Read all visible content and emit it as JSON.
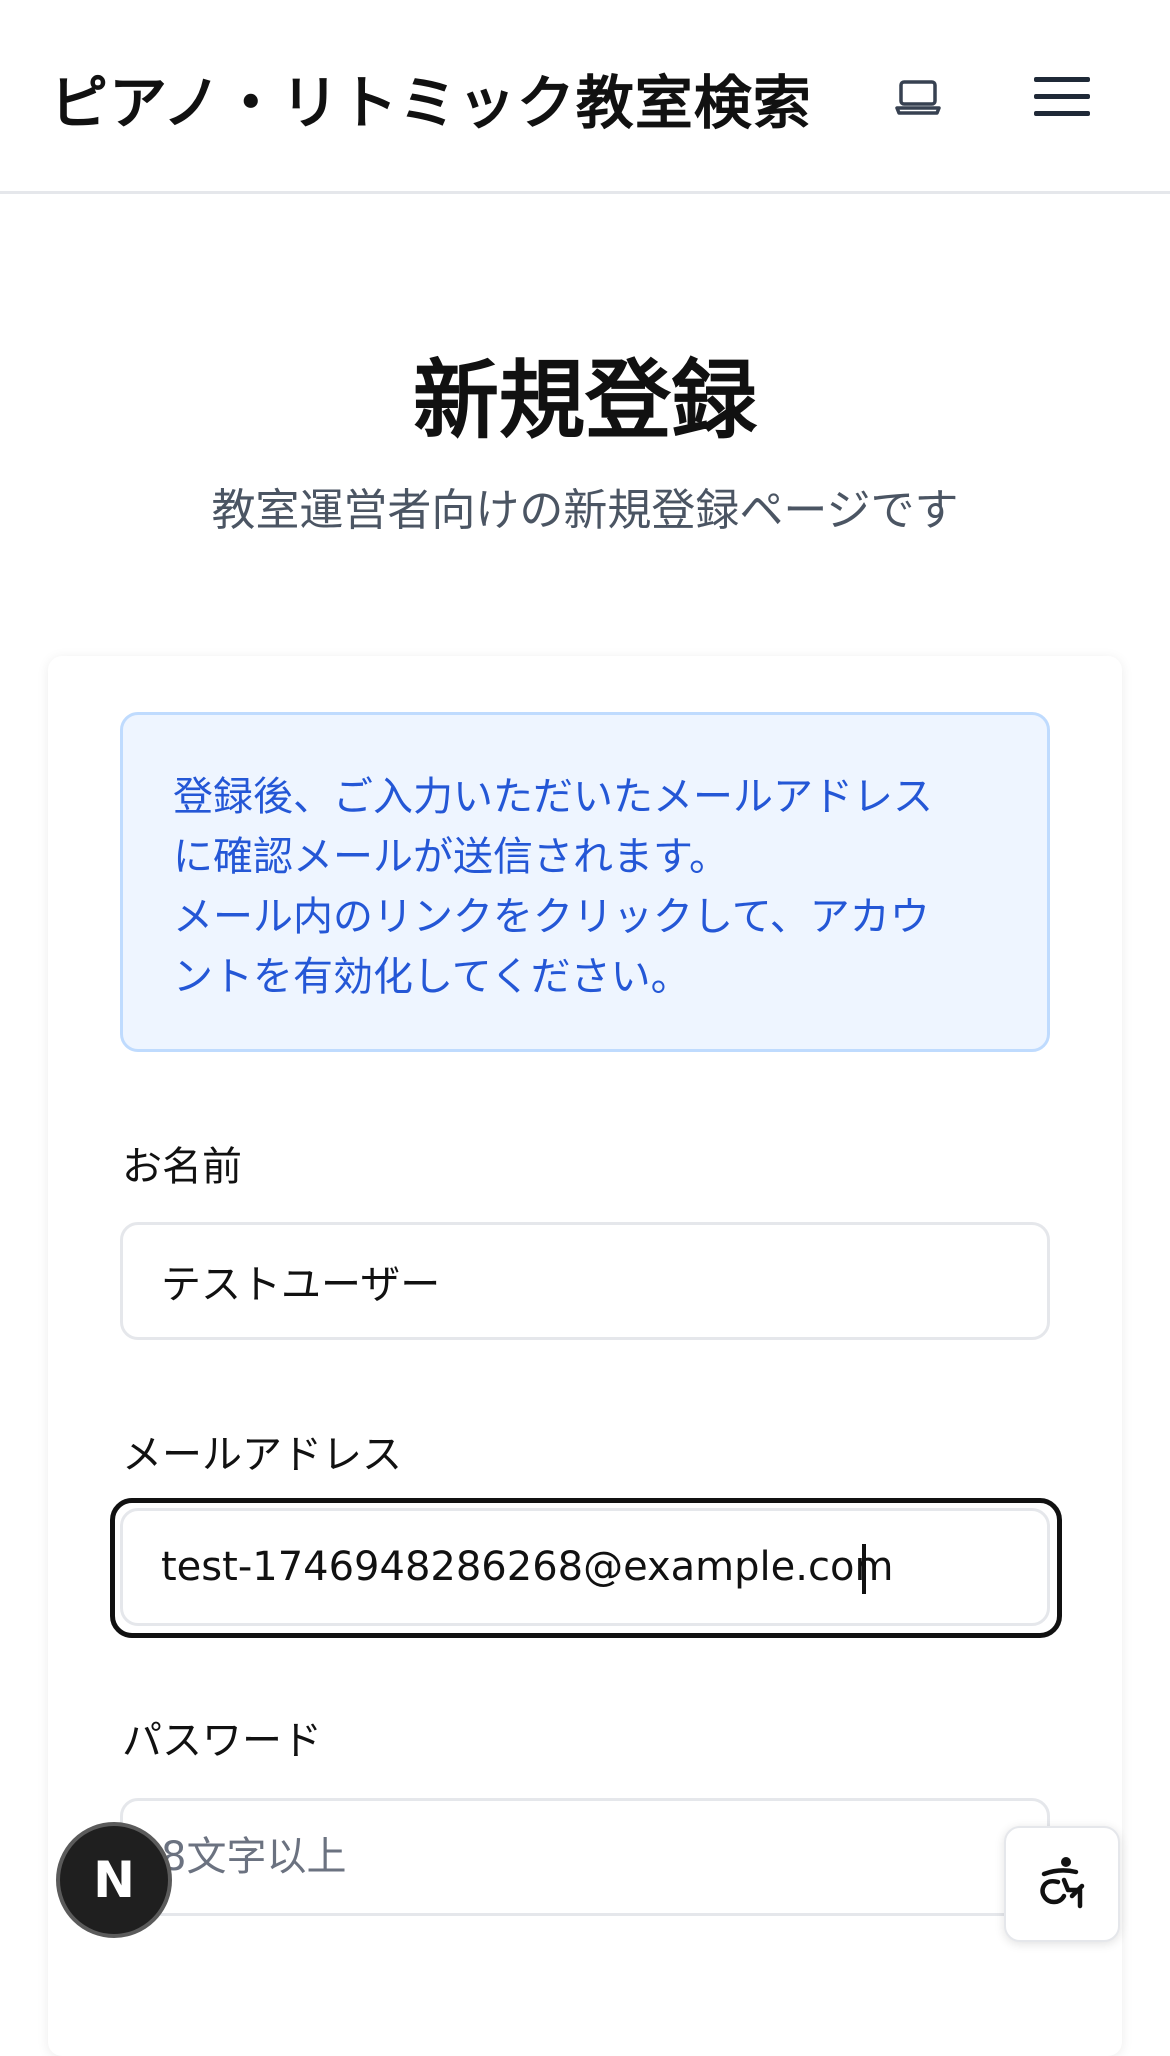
{
  "header": {
    "site_title": "ピアノ・リトミック教室検索",
    "theme_icon": "laptop-icon",
    "menu_icon": "hamburger-menu-icon"
  },
  "main": {
    "title": "新規登録",
    "subtitle": "教室運営者向けの新規登録ページです"
  },
  "notice": {
    "lines": [
      "登録後、ご入力いただいたメールアドレス",
      "に確認メールが送信されます。",
      "メール内のリンクをクリックして、アカウ",
      "ントを有効化してください。"
    ]
  },
  "form": {
    "name": {
      "label": "お名前",
      "value": "テストユーザー"
    },
    "email": {
      "label": "メールアドレス",
      "value": "test-1746948286268@example.com"
    },
    "password": {
      "label": "パスワード",
      "placeholder": "8文字以上"
    }
  },
  "floating": {
    "dev_badge": "N",
    "accessibility_icon": "accessibility-icon"
  },
  "colors": {
    "info_bg": "#eef5ff",
    "info_text": "#2457d6",
    "info_border": "#bfdbfe"
  }
}
